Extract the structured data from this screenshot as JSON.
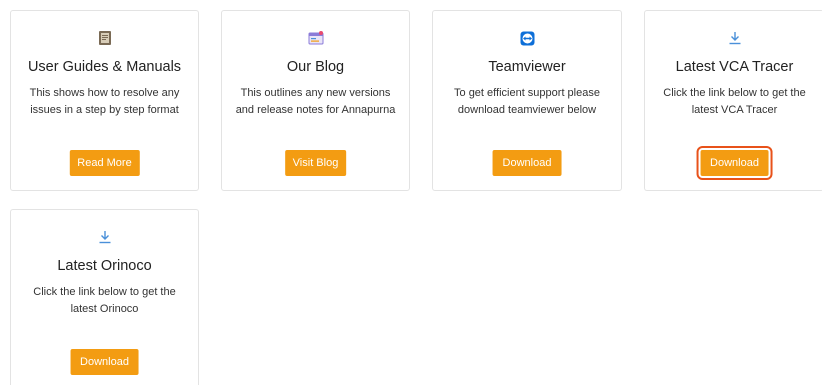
{
  "cards": [
    {
      "icon": "document-icon",
      "title": "User Guides & Manuals",
      "description": "This shows how to resolve any issues in a step by step format",
      "button_label": "Read More"
    },
    {
      "icon": "blog-icon",
      "title": "Our Blog",
      "description": "This outlines any new versions and release notes for Annapurna",
      "button_label": "Visit Blog"
    },
    {
      "icon": "teamviewer-icon",
      "title": "Teamviewer",
      "description": "To get efficient support please download teamviewer below",
      "button_label": "Download"
    },
    {
      "icon": "download-icon",
      "title": "Latest VCA Tracer",
      "description": "Click the link below to get the latest VCA Tracer",
      "button_label": "Download"
    },
    {
      "icon": "download-icon",
      "title": "Latest Orinoco",
      "description": "Click the link below to get the latest Orinoco",
      "button_label": "Download"
    }
  ],
  "colors": {
    "button": "#f39c12",
    "highlight_outline": "#e8521a",
    "download_icon": "#4a90d9",
    "teamviewer_icon": "#0e6fd8"
  }
}
